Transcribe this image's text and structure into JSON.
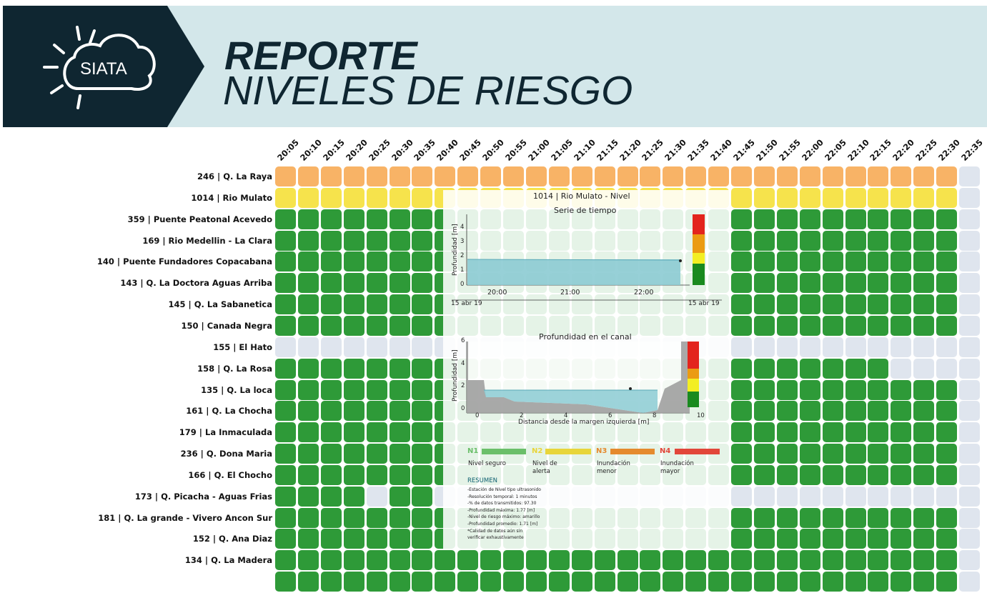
{
  "header": {
    "logo_text": "SIATA",
    "title_line1": "REPORTE",
    "title_line2": "NIVELES DE RIESGO"
  },
  "times": [
    "20:05",
    "20:10",
    "20:15",
    "20:20",
    "20:25",
    "20:30",
    "20:35",
    "20:40",
    "20:45",
    "20:50",
    "20:55",
    "21:00",
    "21:05",
    "21:10",
    "21:15",
    "21:20",
    "21:25",
    "21:30",
    "21:35",
    "21:40",
    "21:45",
    "21:50",
    "21:55",
    "22:00",
    "22:05",
    "22:10",
    "22:15",
    "22:20",
    "22:25",
    "22:30",
    "22:35"
  ],
  "colors": {
    "orange": "#f8b366",
    "yellow": "#f6e34c",
    "green": "#2e9a38",
    "gray": "#dfe5ee",
    "banner_bg": "#d3e7ea",
    "banner_dark": "#0f2631"
  },
  "stations": [
    {
      "label": "246 | Q. La Raya",
      "status": "OOOOOOOOOOOOOOOOOOOOOOOOOOOOOOX"
    },
    {
      "label": "1014 | Rio Mulato",
      "status": "YYYYYYYYYYYYYYYYYYYYYYYYYYYYYYX"
    },
    {
      "label": "359 | Puente Peatonal Acevedo",
      "status": "GGGGGGGGGGGGGGGGGGGGGGGGGGGGGGX"
    },
    {
      "label": "169 | Rio Medellin - La Clara",
      "status": "GGGGGGGGGGGGGGGGGGGGGGGGGGGGGGX"
    },
    {
      "label": "140 | Puente Fundadores Copacabana",
      "status": "GGGGGGGGGGGGGGGGGGGGGGGGGGGGGGX"
    },
    {
      "label": "143 | Q. La Doctora Aguas Arriba",
      "status": "GGGGGGGGGGGGGGGGGGGGGGGGGGGGGGX"
    },
    {
      "label": "145 | Q. La Sabanetica",
      "status": "GGGGGGGGGGGGGGGGGGGGGGGGGGGGGGX"
    },
    {
      "label": "150 | Canada Negra",
      "status": "GGGGGGGGGGGGGGGGGGGGGGGGGGGGGGX"
    },
    {
      "label": "155 | El Hato",
      "status": "XXXXXXXXXXXXXXXXXXXXXXXXXXXXXXX"
    },
    {
      "label": "158 | Q. La Rosa",
      "status": "GGGGGGGGGGGGGGGGGGGGGGGGGGGXXXX"
    },
    {
      "label": "135 | Q. La loca",
      "status": "GGGGGGGGGGGGGGGGGGGGGGGGGGGGGGX"
    },
    {
      "label": "161 | Q. La Chocha",
      "status": "GGGGGGGGGGGGGGGGGGGGGGGGGGGGGGX"
    },
    {
      "label": "179 | La Inmaculada",
      "status": "GGGGGGGGGGGGGGGGGGGGGGGGGGGGGGX"
    },
    {
      "label": "236 | Q. Dona Maria",
      "status": "GGGGGGGGGGGGGGGGGGGGGGGGGGGGGGX"
    },
    {
      "label": "166 | Q. El Chocho",
      "status": "GGGGGGGGGGGGGGGGGGGGGGGGGGGGGGX"
    },
    {
      "label": "173 | Q. Picacha - Aguas Frias",
      "status": "GGGGXGGXXXXXXXXXXXXXXXXXXXXXXXX"
    },
    {
      "label": "181 | Q. La grande - Vivero Ancon Sur",
      "status": "GGGGGGGGGGGGGGGGGGGGGGGGGGGGGGX"
    },
    {
      "label": "152 | Q. Ana Diaz",
      "status": "GGGGGGGGGGGGGGGGGGGGGGGGGGGGGGX"
    },
    {
      "label": "134 | Q. La Madera",
      "status": "GGGGGGGGGGGGGGGGGGGGGGGGGGGGGGX"
    },
    {
      "label": "",
      "status": "GGGGGGGGGGGGGGGGGGGGGGGGGGGGGGX"
    }
  ],
  "popup": {
    "title": "1014 | Rio Mulato - Nivel",
    "ts_title": "Serie de tiempo",
    "ts_ylabel": "Profundidad [m]",
    "ts_yticks": [
      "0",
      "1",
      "2",
      "3",
      "4"
    ],
    "ts_xticks": [
      "20:00",
      "21:00",
      "22:00"
    ],
    "ts_date_start": "15 abr 19",
    "ts_date_end": "15 abr 19",
    "ch_title": "Profundidad en el canal",
    "ch_ylabel": "Profundidad [m]",
    "ch_yticks": [
      "0",
      "2",
      "4",
      "6"
    ],
    "ch_xticks": [
      "0",
      "2",
      "4",
      "6",
      "8",
      "10"
    ],
    "ch_xlabel": "Distancia desde la margen izquierda [m]",
    "legend": [
      {
        "code": "N1",
        "text1": "Nivel seguro",
        "text2": "",
        "color": "#6bbf6a"
      },
      {
        "code": "N2",
        "text1": "Nivel de",
        "text2": "alerta",
        "color": "#e8d53a"
      },
      {
        "code": "N3",
        "text1": "Inundación",
        "text2": "menor",
        "color": "#e58a2e"
      },
      {
        "code": "N4",
        "text1": "Inundación",
        "text2": "mayor",
        "color": "#e2463a"
      }
    ],
    "resumen_title": "RESUMEN",
    "resumen_lines": [
      "-Estación de Nivel tipo ultrasonido",
      "-Resolución temporal: 1 minutos",
      "-% de datos transmitidos: 97.30",
      "-Profundidad máxima: 1.77 [m]",
      "-Nivel de riesgo máximo: amarillo",
      "-Profundidad promedio: 1.71 [m]",
      "*Calidad de datos aún sin",
      " verificar exhaustivamente"
    ]
  }
}
